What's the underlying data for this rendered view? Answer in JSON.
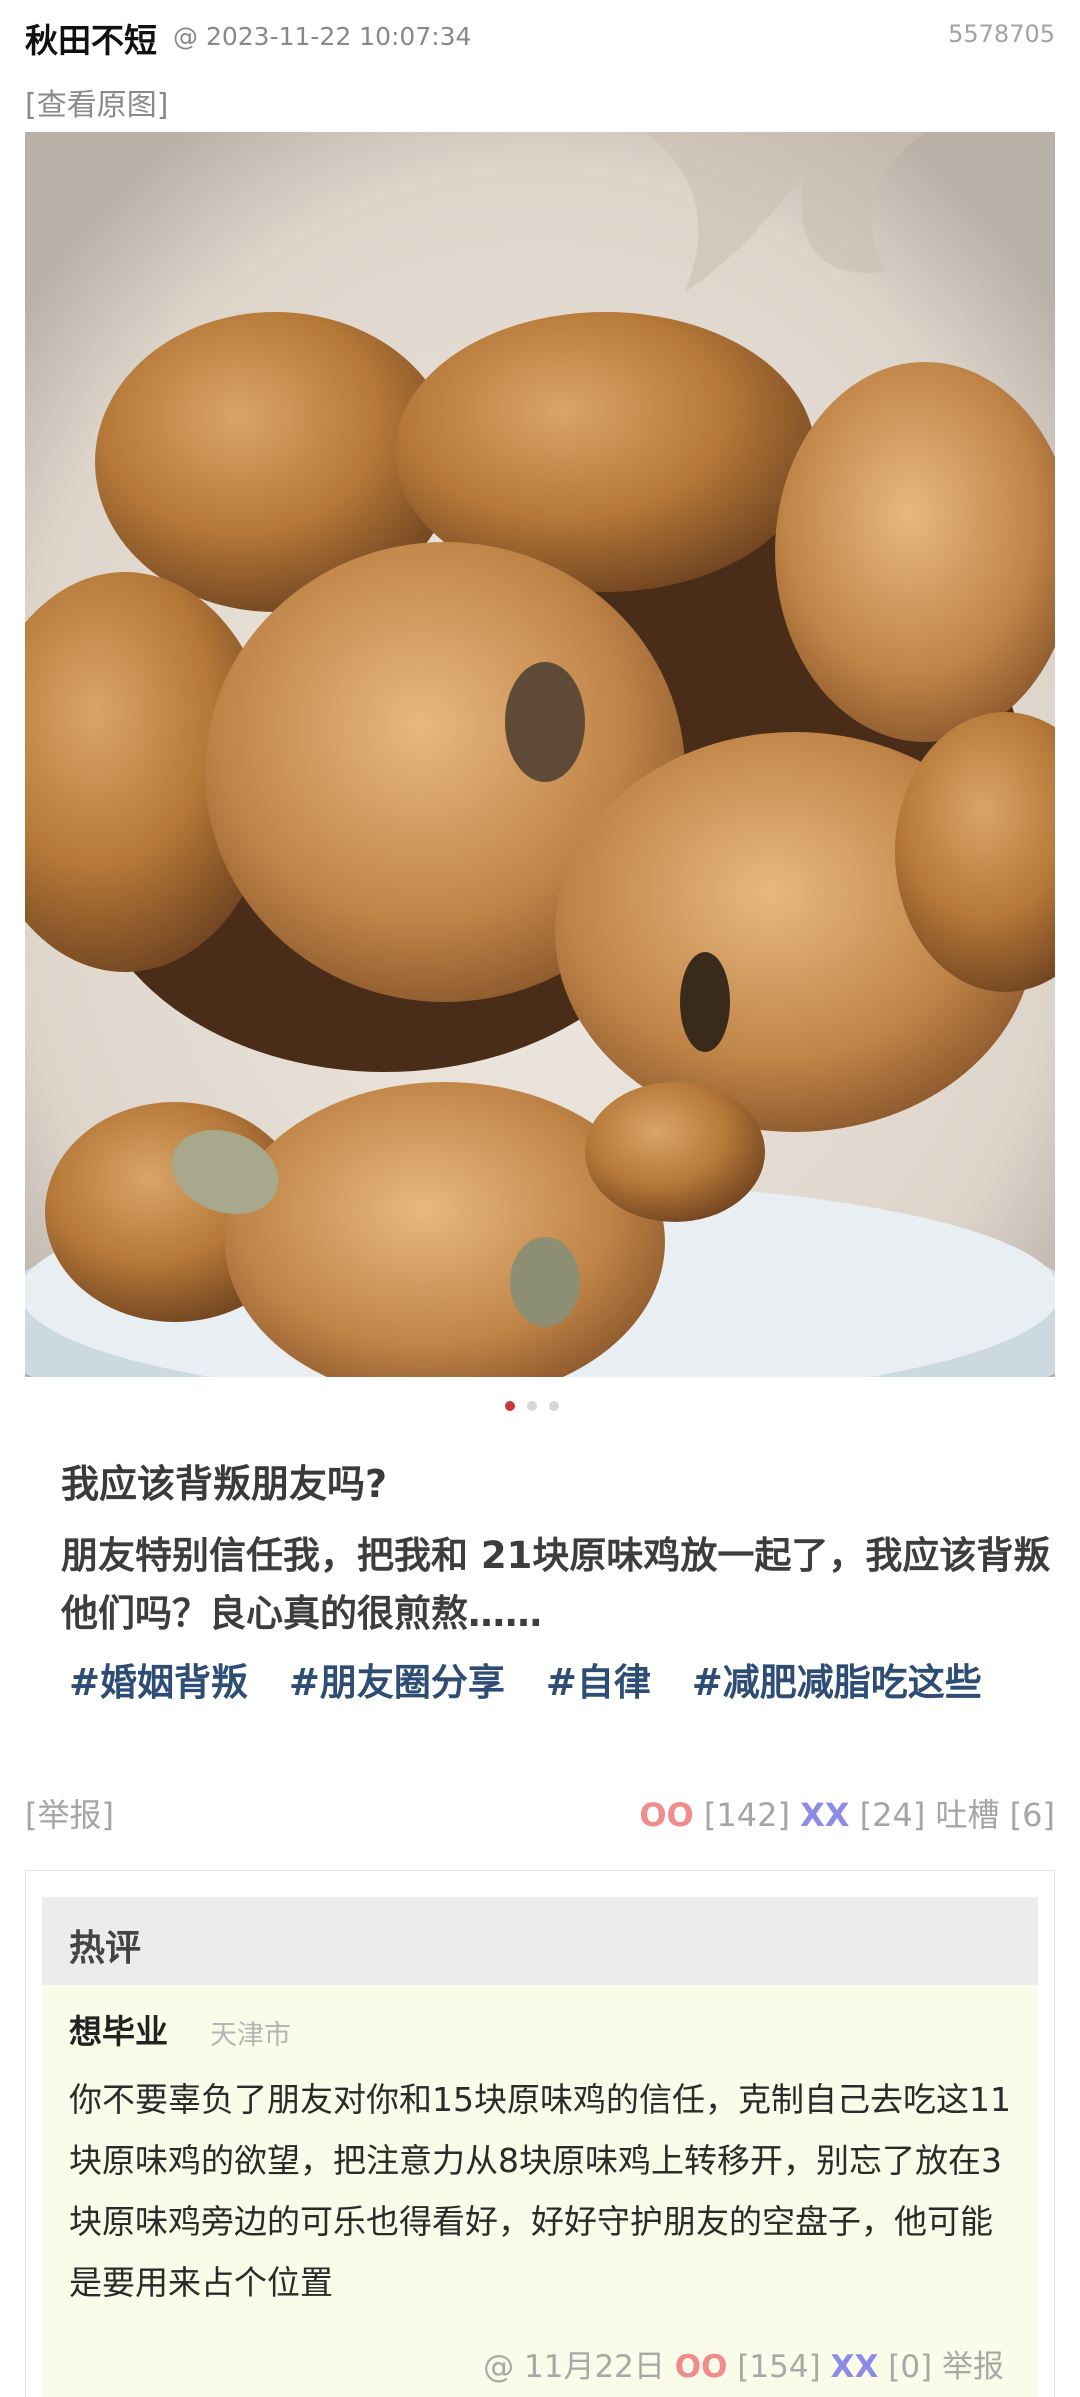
{
  "post": {
    "author": "秋田不短",
    "timestamp": "@ 2023-11-22 10:07:34",
    "post_id": "5578705",
    "view_original": "[查看原图]"
  },
  "image": {
    "dots": 3,
    "active_dot": 0,
    "question_title": "我应该背叛朋友吗?",
    "question_body": "朋友特别信任我，把我和 21块原味鸡放一起了，我应该背叛他们吗？良心真的很煎熬……",
    "tags": [
      "#婚姻背叛",
      "#朋友圈分享",
      "#自律",
      "#减肥减脂吃这些"
    ]
  },
  "actions": {
    "report": "[举报]",
    "oo_label": "OO",
    "oo_count": "[142]",
    "xx_label": "XX",
    "xx_count": "[24]",
    "tucao": "吐槽 [6]"
  },
  "hot_comment": {
    "title": "热评",
    "commenter": "想毕业",
    "location": "天津市",
    "text": "你不要辜负了朋友对你和15块原味鸡的信任，克制自己去吃这11块原味鸡的欲望，把注意力从8块原味鸡上转移开，别忘了放在3块原味鸡旁边的可乐也得看好，好好守护朋友的空盘子，他可能是要用来占个位置",
    "date": "@ 11月22日",
    "oo_label": "OO",
    "oo_count": "[154]",
    "xx_label": "XX",
    "xx_count": "[0]",
    "report": "举报"
  },
  "colors": {
    "oo": "#f08c8c",
    "xx": "#8c8ce8",
    "tag": "#2d4d75",
    "hot_header_bg": "#ececec",
    "comment_bg": "#fbfbe9"
  }
}
